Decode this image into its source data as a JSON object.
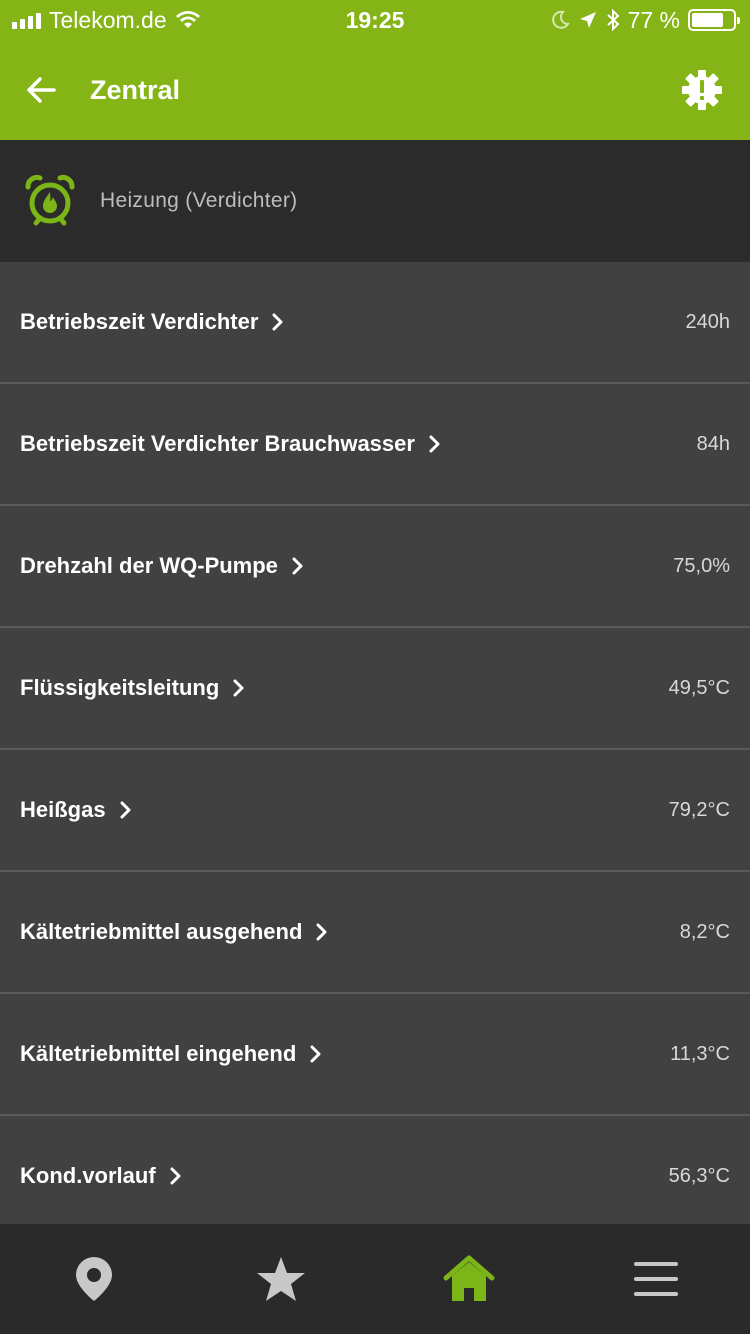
{
  "status_bar": {
    "carrier": "Telekom.de",
    "time": "19:25",
    "battery": "77 %",
    "battery_level": 0.77,
    "icons": [
      "signal-icon",
      "wifi-icon",
      "moon-icon",
      "location-icon",
      "bluetooth-icon",
      "battery-icon"
    ]
  },
  "header": {
    "title": "Zentral",
    "back_icon": "arrow-left-icon",
    "settings_icon": "gear-alert-icon"
  },
  "section": {
    "title": "Heizung (Verdichter)",
    "icon": "alarm-flame-icon"
  },
  "items": [
    {
      "label": "Betriebszeit Verdichter",
      "value": "240h"
    },
    {
      "label": "Betriebszeit Verdichter Brauchwasser",
      "value": "84h"
    },
    {
      "label": "Drehzahl der WQ-Pumpe",
      "value": "75,0%"
    },
    {
      "label": "Flüssigkeitsleitung",
      "value": "49,5°C"
    },
    {
      "label": "Heißgas",
      "value": "79,2°C"
    },
    {
      "label": "Kältetriebmittel ausgehend",
      "value": "8,2°C"
    },
    {
      "label": "Kältetriebmittel eingehend",
      "value": "11,3°C"
    },
    {
      "label": "Kond.vorlauf",
      "value": "56,3°C"
    }
  ],
  "nav": [
    {
      "icon": "location-pin-icon",
      "active": false
    },
    {
      "icon": "star-icon",
      "active": false
    },
    {
      "icon": "home-icon",
      "active": true
    },
    {
      "icon": "menu-icon",
      "active": false
    }
  ],
  "colors": {
    "brand_green": "#84b415",
    "background": "#414141",
    "header_dark": "#2b2b2b",
    "nav_inactive": "#c8c8c8"
  }
}
